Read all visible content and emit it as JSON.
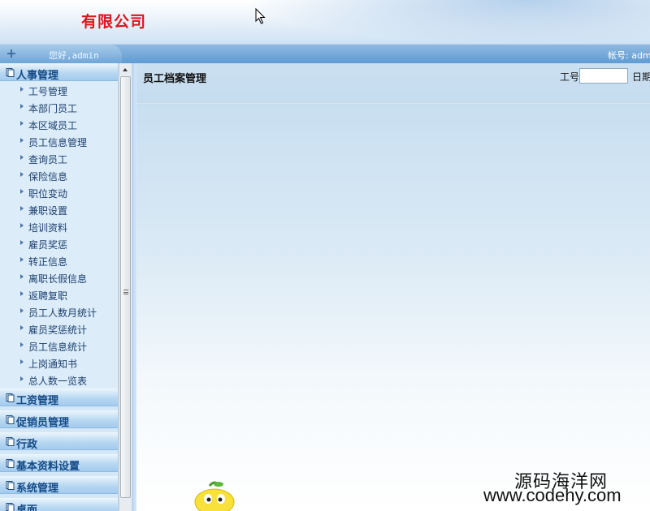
{
  "header": {
    "company_name": "有限公司"
  },
  "infobar": {
    "greeting": "您好,admin",
    "account": "帐号: admin"
  },
  "sidebar": {
    "active_section": "人事管理",
    "items": [
      "工号管理",
      "本部门员工",
      "本区域员工",
      "员工信息管理",
      "查询员工",
      "保险信息",
      "职位变动",
      "兼职设置",
      "培训资料",
      "雇员奖惩",
      "转正信息",
      "离职长假信息",
      "返聘复职",
      "员工人数月统计",
      "雇员奖惩统计",
      "员工信息统计",
      "上岗通知书",
      "总人数一览表"
    ],
    "sections": [
      "工资管理",
      "促销员管理",
      "行政",
      "基本资料设置",
      "系统管理",
      "桌面"
    ]
  },
  "main": {
    "title": "员工档案管理",
    "employee_no_label": "工号",
    "employee_no_value": "",
    "date_label": "日期"
  },
  "watermark": {
    "line1": "源码海洋网",
    "line2": "www.codehy.com"
  },
  "colors": {
    "company_name": "#e0141e",
    "section_label": "#134a87",
    "infobar": "#5f9bd2"
  }
}
